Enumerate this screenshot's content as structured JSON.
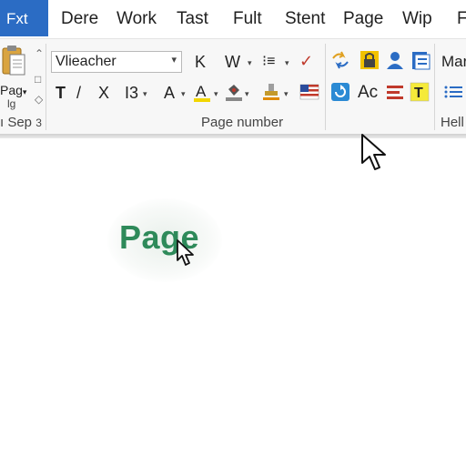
{
  "menu": {
    "tabs": [
      {
        "label": "Fxt",
        "active": true
      },
      {
        "label": "Dere"
      },
      {
        "label": "Work"
      },
      {
        "label": "Tast"
      },
      {
        "label": "Fult"
      },
      {
        "label": "Stent"
      },
      {
        "label": "Page"
      },
      {
        "label": "Wip"
      },
      {
        "label": "F"
      }
    ]
  },
  "ribbon": {
    "clipboard": {
      "paste_label": "Pag",
      "paste_caret": "▾",
      "paste_sub": "lg",
      "group_label": "ı Sep",
      "group_suffix": "3"
    },
    "font": {
      "font_name": "Vlieacher",
      "font_dropdown": "▾",
      "row1": {
        "k": "K",
        "w": "W",
        "w_caret": "▾",
        "list": "⁝≡",
        "list_caret": "▾",
        "check": "✓"
      },
      "row2": {
        "t": "T",
        "slash": "/",
        "x": "X",
        "b3": "I3",
        "b3_caret": "▾",
        "a": "A",
        "a_caret": "▾",
        "a_caret2": "▾",
        "shade_caret": "▾",
        "stamp_caret": "▾",
        "stamp2_caret": "▾"
      }
    },
    "page_group_label": "Page number",
    "styles": {
      "ac": "Ac",
      "ma": "Mar",
      "hell": "Hell"
    }
  },
  "document": {
    "word": "Page"
  },
  "colors": {
    "accent": "#2b6cc4",
    "page_text": "#2e8a5a",
    "check": "#c0392b"
  }
}
